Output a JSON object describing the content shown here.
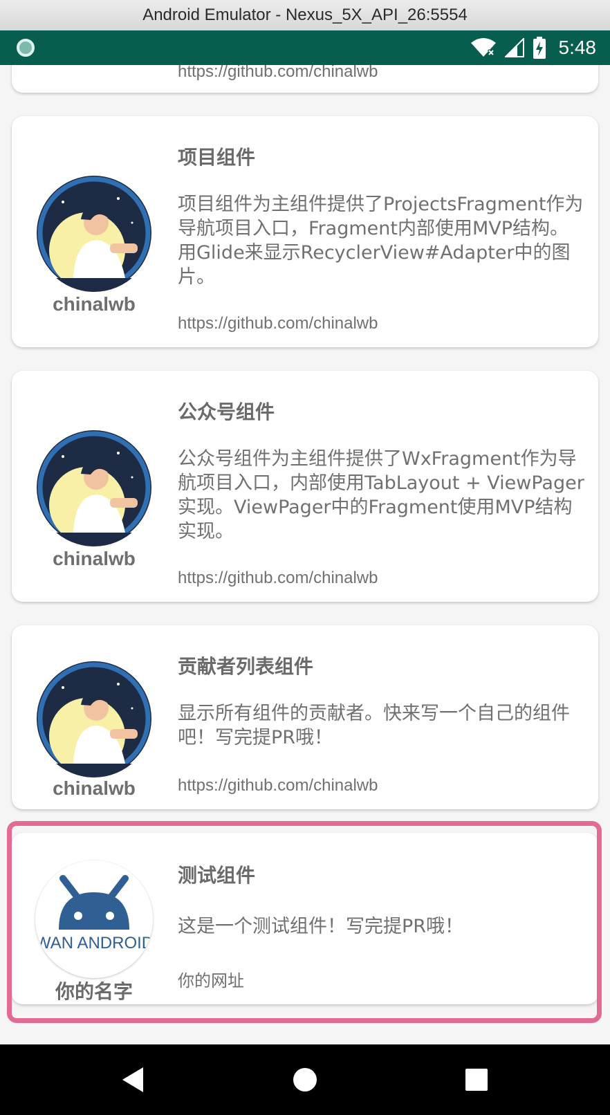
{
  "window": {
    "title": "Android Emulator - Nexus_5X_API_26:5554"
  },
  "status_bar": {
    "time": "5:48",
    "background": "#075e4e"
  },
  "cards": [
    {
      "title": "",
      "description": "",
      "url": "https://github.com/chinalwb",
      "author": ""
    },
    {
      "title": "项目组件",
      "description": "项目组件为主组件提供了ProjectsFragment作为导航项目入口，Fragment内部使用MVP结构。用Glide来显示RecyclerView#Adapter中的图片。",
      "url": "https://github.com/chinalwb",
      "author": "chinalwb"
    },
    {
      "title": "公众号组件",
      "description": "公众号组件为主组件提供了WxFragment作为导航项目入口，内部使用TabLayout + ViewPager实现。ViewPager中的Fragment使用MVP结构实现。",
      "url": "https://github.com/chinalwb",
      "author": "chinalwb"
    },
    {
      "title": "贡献者列表组件",
      "description": "显示所有组件的贡献者。快来写一个自己的组件吧！写完提PR哦！",
      "url": "https://github.com/chinalwb",
      "author": "chinalwb"
    },
    {
      "title": "测试组件",
      "description": "这是一个测试组件！写完提PR哦！",
      "url": "你的网址",
      "author": "你的名字",
      "logo_text": "WAN ANDROID"
    }
  ],
  "colors": {
    "highlight_border": "#e36a95",
    "android_logo_blue": "#2f5f93"
  },
  "nav_bar": {
    "icons": [
      "back-icon",
      "home-icon",
      "recents-icon"
    ]
  }
}
